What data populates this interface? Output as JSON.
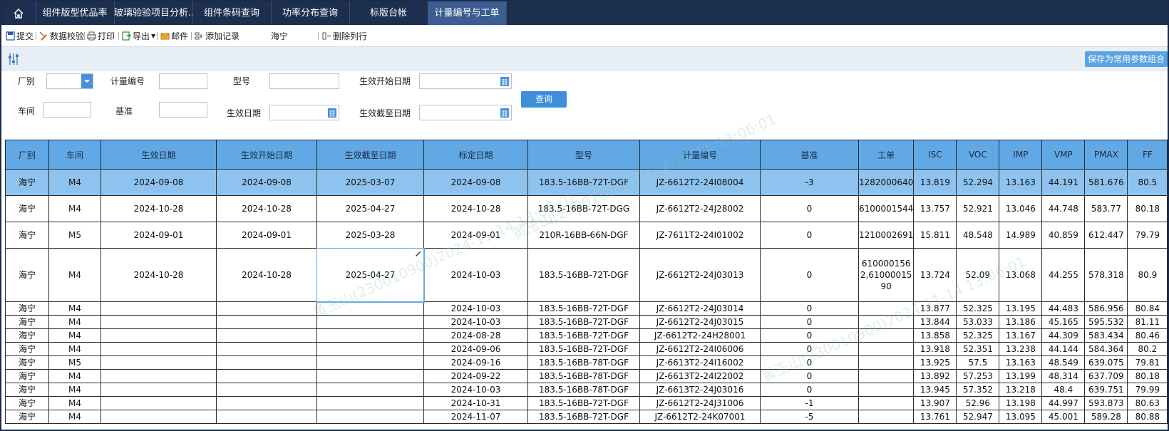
{
  "nav": {
    "tabs": [
      {
        "label": "组件版型优品率"
      },
      {
        "label": "玻璃验验项目分析..."
      },
      {
        "label": "组件条码查询"
      },
      {
        "label": "功率分布查询"
      },
      {
        "label": "标版台帐"
      },
      {
        "label": "计量编号与工单"
      }
    ]
  },
  "toolbar": {
    "submit": "提交",
    "validate": "数据校验",
    "print": "打印",
    "export": "导出",
    "mail": "邮件",
    "add_record": "添加记录",
    "location": "海宁",
    "delete_row": "删除列行"
  },
  "filterbar": {
    "save_label": "保存为常用参数组合"
  },
  "form": {
    "factory_label": "厂别",
    "meter_no_label": "计量编号",
    "model_label": "型号",
    "start_date_label": "生效开始日期",
    "workshop_label": "车间",
    "benchmark_label": "基准",
    "effective_date_label": "生效日期",
    "end_date_label": "生效截至日期",
    "query_button": "查询"
  },
  "table": {
    "headers": [
      "厂别",
      "车间",
      "生效日期",
      "生效开始日期",
      "生效截至日期",
      "标定日期",
      "型号",
      "计量编号",
      "基准",
      "工单",
      "ISC",
      "VOC",
      "IMP",
      "VMP",
      "PMAX",
      "FF"
    ],
    "rows": [
      [
        "海宁",
        "M4",
        "2024-09-08",
        "2024-09-08",
        "2025-03-07",
        "2024-09-08",
        "183.5-16BB-72T-DGF",
        "JZ-6612T2-24I08004",
        "-3",
        "1282000640",
        "13.819",
        "52.294",
        "13.163",
        "44.191",
        "581.676",
        "80.5"
      ],
      [
        "海宁",
        "M4",
        "2024-10-28",
        "2024-10-28",
        "2025-04-27",
        "2024-10-28",
        "183.5-16BB-72T-DGG",
        "JZ-6612T2-24J28002",
        "0",
        "6100001544",
        "13.757",
        "52.921",
        "13.046",
        "44.748",
        "583.77",
        "80.18"
      ],
      [
        "海宁",
        "M5",
        "2024-09-01",
        "2024-09-01",
        "2025-03-28",
        "2024-09-01",
        "210R-16BB-66N-DGF",
        "JZ-7611T2-24I01002",
        "0",
        "1210002691",
        "15.811",
        "48.548",
        "14.989",
        "40.859",
        "612.447",
        "79.79"
      ],
      [
        "海宁",
        "M4",
        "2024-10-28",
        "2024-10-28",
        "2025-04-27",
        "2024-10-03",
        "183.5-16BB-72T-DGF",
        "JZ-6612T2-24J03013",
        "0",
        "6100001562,6100001590",
        "13.724",
        "52.09",
        "13.068",
        "44.255",
        "578.318",
        "80.9"
      ],
      [
        "海宁",
        "M4",
        "",
        "",
        "",
        "2024-10-03",
        "183.5-16BB-72T-DGF",
        "JZ-6612T2-24J03014",
        "0",
        "",
        "13.877",
        "52.325",
        "13.195",
        "44.483",
        "586.956",
        "80.84"
      ],
      [
        "海宁",
        "M4",
        "",
        "",
        "",
        "2024-10-03",
        "183.5-16BB-72T-DGF",
        "JZ-6612T2-24J03015",
        "0",
        "",
        "13.844",
        "53.033",
        "13.186",
        "45.165",
        "595.532",
        "81.11"
      ],
      [
        "海宁",
        "M4",
        "",
        "",
        "",
        "2024-08-28",
        "183.5-16BB-72T-DGF",
        "JZ-6612T2-24H28001",
        "0",
        "",
        "13.858",
        "52.325",
        "13.167",
        "44.309",
        "583.434",
        "80.46"
      ],
      [
        "海宁",
        "M4",
        "",
        "",
        "",
        "2024-09-06",
        "183.5-16BB-72T-DGF",
        "JZ-6612T2-24I06006",
        "0",
        "",
        "13.918",
        "52.351",
        "13.238",
        "44.144",
        "584.364",
        "80.2"
      ],
      [
        "海宁",
        "M5",
        "",
        "",
        "",
        "2024-09-16",
        "183.5-16BB-78T-DGF",
        "JZ-6613T2-24I16002",
        "0",
        "",
        "13.925",
        "57.5",
        "13.163",
        "48.549",
        "639.075",
        "79.81"
      ],
      [
        "海宁",
        "M4",
        "",
        "",
        "",
        "2024-09-22",
        "183.5-16BB-78T-DGF",
        "JZ-6613T2-24I22002",
        "0",
        "",
        "13.892",
        "57.253",
        "13.199",
        "48.314",
        "637.709",
        "80.18"
      ],
      [
        "海宁",
        "M4",
        "",
        "",
        "",
        "2024-10-03",
        "183.5-16BB-78T-DGF",
        "JZ-6613T2-24J03016",
        "0",
        "",
        "13.945",
        "57.352",
        "13.218",
        "48.4",
        "639.751",
        "79.99"
      ],
      [
        "海宁",
        "M4",
        "",
        "",
        "",
        "2024-10-31",
        "183.5-16BB-72T-DGF",
        "JZ-6612T2-24J31006",
        "-1",
        "",
        "13.907",
        "52.96",
        "13.198",
        "44.997",
        "593.873",
        "80.63"
      ],
      [
        "海宁",
        "M4",
        "",
        "",
        "",
        "2024-11-07",
        "183.5-16BB-72T-DGF",
        "JZ-6612T2-24K07001",
        "-5",
        "",
        "13.761",
        "52.947",
        "13.095",
        "45.001",
        "589.28",
        "80.88"
      ]
    ]
  },
  "colors": {
    "nav_bg": "#1d2f4f",
    "active_tab": "#3b5d8f",
    "header_bg": "#62a8e5",
    "selected_row": "#8ec3ef",
    "button": "#3c8fd8"
  }
}
